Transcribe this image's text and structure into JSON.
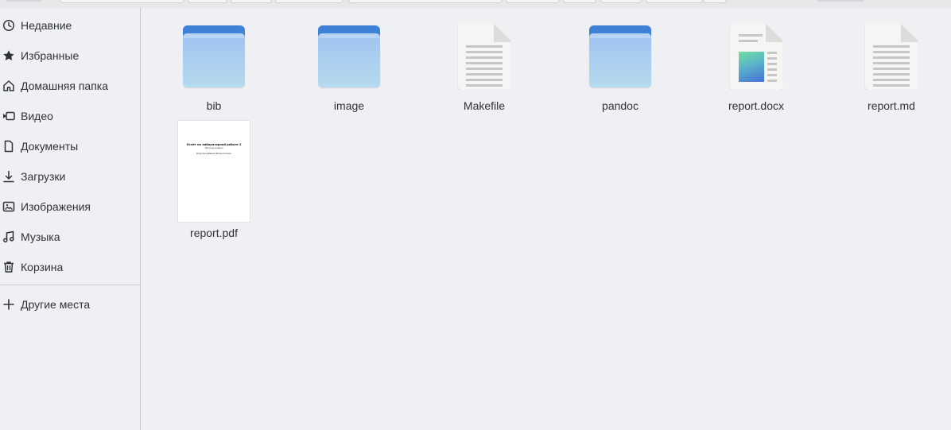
{
  "sidebar": {
    "items": [
      {
        "label": "Недавние",
        "icon": "clock-icon"
      },
      {
        "label": "Избранные",
        "icon": "star-icon"
      },
      {
        "label": "Домашняя папка",
        "icon": "home-icon"
      },
      {
        "label": "Видео",
        "icon": "video-icon"
      },
      {
        "label": "Документы",
        "icon": "document-icon"
      },
      {
        "label": "Загрузки",
        "icon": "download-icon"
      },
      {
        "label": "Изображения",
        "icon": "image-icon"
      },
      {
        "label": "Музыка",
        "icon": "music-icon"
      },
      {
        "label": "Корзина",
        "icon": "trash-icon"
      }
    ],
    "other_places": {
      "label": "Другие места",
      "icon": "plus-icon"
    }
  },
  "files": [
    {
      "name": "bib",
      "type": "folder"
    },
    {
      "name": "image",
      "type": "folder"
    },
    {
      "name": "Makefile",
      "type": "text"
    },
    {
      "name": "pandoc",
      "type": "folder"
    },
    {
      "name": "report.docx",
      "type": "docx"
    },
    {
      "name": "report.md",
      "type": "text"
    },
    {
      "name": "report.pdf",
      "type": "pdf"
    }
  ],
  "pdf_preview": {
    "title": "Отчёт по лабораторной работе 1",
    "subtitle": "Простые модели",
    "author": "Исаргаков Вадим Валентинович"
  },
  "colors": {
    "folder_back": "#3e82d8",
    "folder_front": "#9fc3f0",
    "background": "#eff0f3"
  }
}
